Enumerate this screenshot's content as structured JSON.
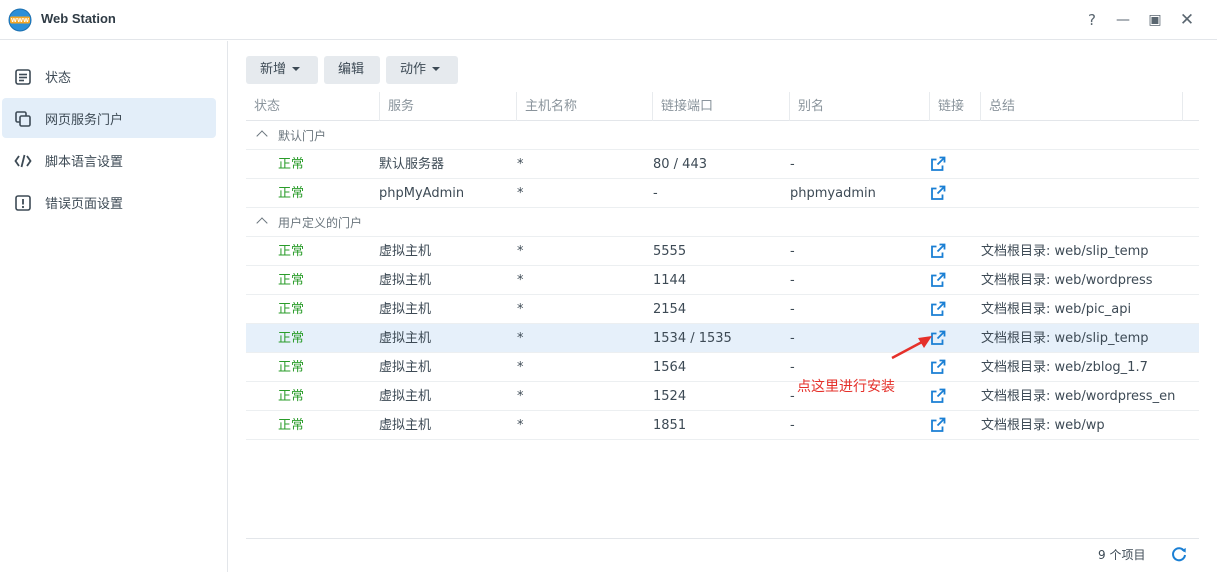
{
  "window": {
    "title": "Web Station",
    "help": "?",
    "min": "—",
    "max": "▣",
    "close": "✕"
  },
  "sidebar": {
    "items": [
      {
        "label": "状态",
        "icon": "list-icon"
      },
      {
        "label": "网页服务门户",
        "icon": "portal-icon",
        "active": true
      },
      {
        "label": "脚本语言设置",
        "icon": "code-icon"
      },
      {
        "label": "错误页面设置",
        "icon": "warning-icon"
      }
    ]
  },
  "toolbar": {
    "add_label": "新增",
    "edit_label": "编辑",
    "action_label": "动作"
  },
  "table": {
    "columns": [
      "状态",
      "服务",
      "主机名称",
      "链接端口",
      "别名",
      "链接",
      "总结"
    ],
    "groups": [
      {
        "label": "默认门户",
        "rows": [
          {
            "status": "正常",
            "service": "默认服务器",
            "host": "*",
            "port": "80 / 443",
            "alias": "-",
            "summary": ""
          },
          {
            "status": "正常",
            "service": "phpMyAdmin",
            "host": "*",
            "port": "-",
            "alias": "phpmyadmin",
            "summary": ""
          }
        ]
      },
      {
        "label": "用户定义的门户",
        "rows": [
          {
            "status": "正常",
            "service": "虚拟主机",
            "host": "*",
            "port": "5555",
            "alias": "-",
            "summary": "文档根目录: web/slip_temp"
          },
          {
            "status": "正常",
            "service": "虚拟主机",
            "host": "*",
            "port": "1144",
            "alias": "-",
            "summary": "文档根目录: web/wordpress"
          },
          {
            "status": "正常",
            "service": "虚拟主机",
            "host": "*",
            "port": "2154",
            "alias": "-",
            "summary": "文档根目录: web/pic_api"
          },
          {
            "status": "正常",
            "service": "虚拟主机",
            "host": "*",
            "port": "1534 / 1535",
            "alias": "-",
            "summary": "文档根目录: web/slip_temp",
            "selected": true
          },
          {
            "status": "正常",
            "service": "虚拟主机",
            "host": "*",
            "port": "1564",
            "alias": "-",
            "summary": "文档根目录: web/zblog_1.7"
          },
          {
            "status": "正常",
            "service": "虚拟主机",
            "host": "*",
            "port": "1524",
            "alias": "-",
            "summary": "文档根目录: web/wordpress_en"
          },
          {
            "status": "正常",
            "service": "虚拟主机",
            "host": "*",
            "port": "1851",
            "alias": "-",
            "summary": "文档根目录: web/wp"
          }
        ]
      }
    ],
    "footer_count": "9 个项目"
  },
  "annotation": {
    "text": "点这里进行安装",
    "color": "#e5302a"
  },
  "colors": {
    "accent": "#1a7fd4",
    "status_ok": "#2a9c2a",
    "selected_row": "#e6f0fa",
    "sidebar_active": "#e3eef9"
  }
}
